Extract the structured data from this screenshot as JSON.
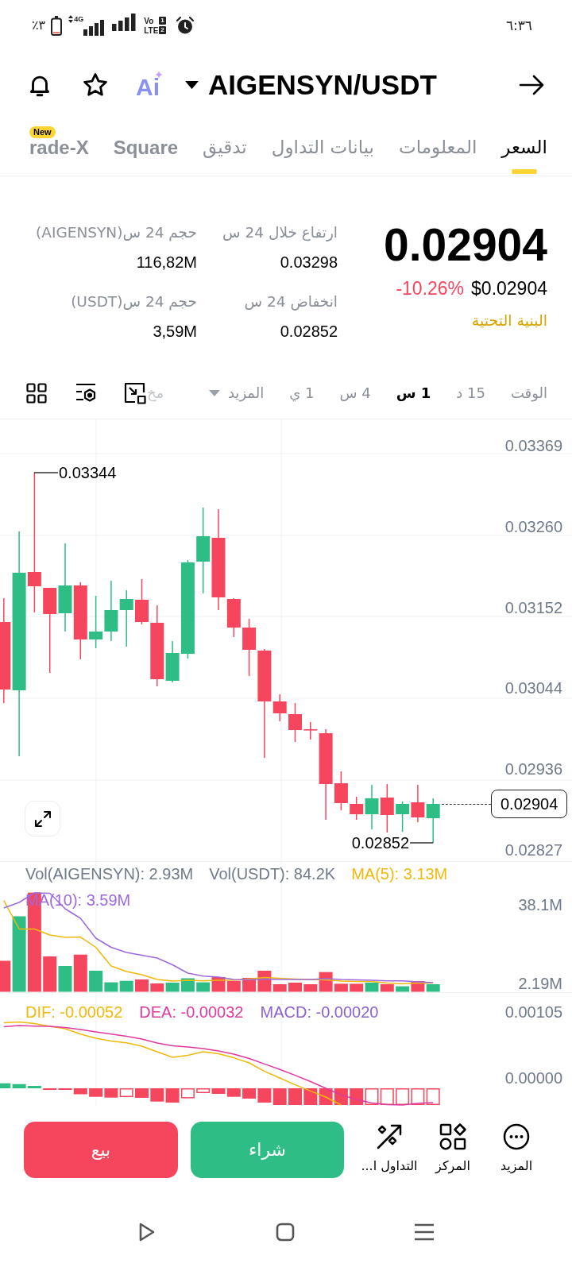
{
  "status_bar": {
    "time": "٦:٣٦",
    "volte_top": "Vo",
    "volte_bottom": "LTE",
    "sim_slots": [
      "1",
      "2"
    ],
    "network": "4G",
    "battery": "٣٪"
  },
  "header": {
    "pair": "AIGENSYN/USDT",
    "logo": "Ai"
  },
  "tabs": [
    {
      "label": "السعر",
      "selected": true
    },
    {
      "label": "المعلومات",
      "selected": false
    },
    {
      "label": "بيانات التداول",
      "selected": false
    },
    {
      "label": "تدقيق",
      "selected": false
    },
    {
      "label": "Square",
      "selected": false
    },
    {
      "label": "rade-X",
      "badge": "New",
      "selected": false
    }
  ],
  "ticker": {
    "price": "0.02904",
    "price_usd": "$0.02904",
    "change": "-10.26%",
    "tag": "البنية التحتية"
  },
  "stats": [
    {
      "label": "ارتفاع خلال 24 س",
      "value": "0.03298"
    },
    {
      "label": "حجم 24 س(AIGENSYN)",
      "value": "116,82M"
    },
    {
      "label": "انخفاض 24 س",
      "value": "0.02852"
    },
    {
      "label": "حجم 24 س(USDT)",
      "value": "3,59M"
    }
  ],
  "intervals": [
    {
      "label": "الوقت",
      "selected": false
    },
    {
      "label": "15 د",
      "selected": false
    },
    {
      "label": "1 س",
      "selected": true
    },
    {
      "label": "4 س",
      "selected": false
    },
    {
      "label": "1 ي",
      "selected": false
    }
  ],
  "more_intervals": "المزيد",
  "partial_tab": "مخ",
  "chart": {
    "price_axis": [
      "0.03369",
      "0.03260",
      "0.03152",
      "0.03044",
      "0.02936",
      "0.02827"
    ],
    "high_label": "0.03344",
    "low_label": "0.02852",
    "last_price": "0.02904"
  },
  "volume": {
    "legend_rows": [
      [
        {
          "text": "MA(5): 3.13M",
          "color": "#f0b90b"
        },
        {
          "text": "Vol(USDT): 84.2K",
          "color": "#707a8a"
        },
        {
          "text": "Vol(AIGENSYN): 2.93M",
          "color": "#707a8a"
        }
      ],
      [
        {
          "text": "MA(10): 3.59M",
          "color": "#9c6ade"
        }
      ]
    ],
    "axis": [
      "38.1M",
      "2.19M"
    ]
  },
  "macd": {
    "legend": [
      {
        "text": "MACD: -0.00020",
        "color": "#8c62d1"
      },
      {
        "text": "DEA: -0.00032",
        "color": "#e0399f"
      },
      {
        "text": "DIF: -0.00052",
        "color": "#f0b90b"
      }
    ],
    "axis": [
      "0.00105",
      "0.00000"
    ]
  },
  "actions": [
    {
      "kind": "more",
      "label": "المزيد"
    },
    {
      "kind": "hub",
      "label": "المركز"
    },
    {
      "kind": "trade",
      "label": "التداول ا..."
    }
  ],
  "order_buttons": [
    {
      "kind": "buy",
      "label": "شراء"
    },
    {
      "kind": "sell",
      "label": "بيع"
    }
  ]
}
